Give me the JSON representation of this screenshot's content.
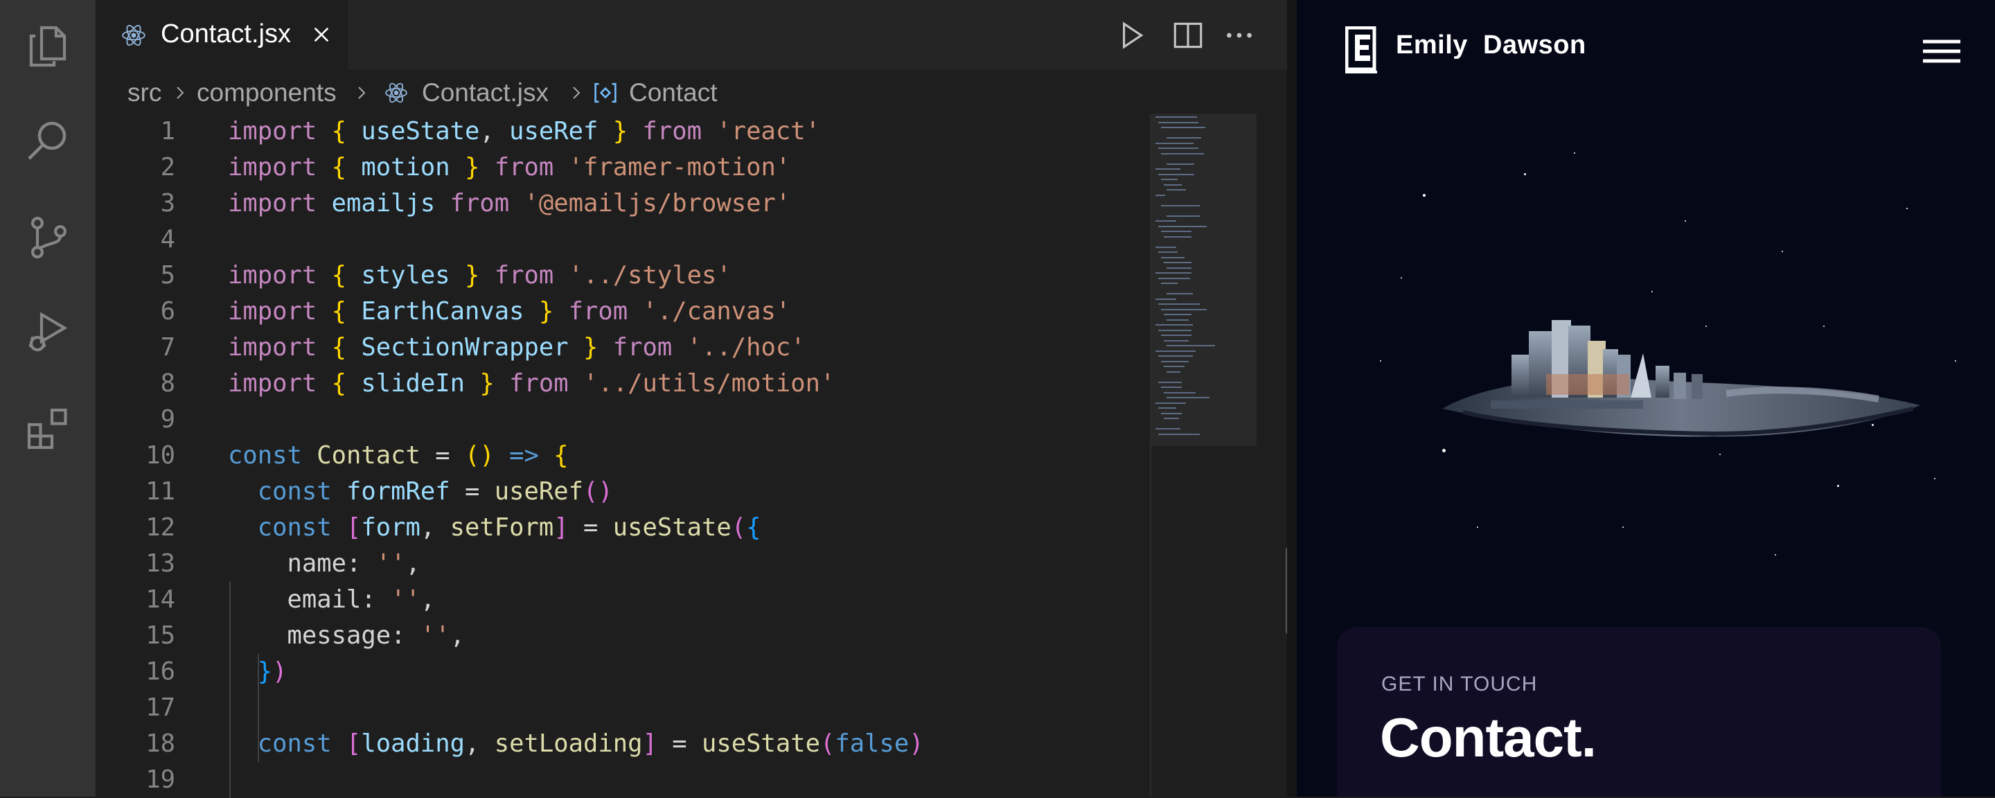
{
  "editor": {
    "tab": {
      "label": "Contact.jsx"
    },
    "breadcrumb": {
      "items": [
        "src",
        "components",
        "Contact.jsx",
        "Contact"
      ]
    },
    "line_numbers": [
      "1",
      "2",
      "3",
      "4",
      "5",
      "6",
      "7",
      "8",
      "9",
      "10",
      "11",
      "12",
      "13",
      "14",
      "15",
      "16",
      "17",
      "18",
      "19"
    ],
    "code_tokens": {
      "import": "import",
      "from": "from",
      "const": "const",
      "false": "false",
      "lb": "{",
      "rb": "}",
      "lp": "(",
      "rp": ")",
      "lbk": "[",
      "rbk": "]",
      "comma": ",",
      "eq": " = ",
      "arrow": " => ",
      "useState": "useState",
      "useRef": "useRef",
      "motion": "motion",
      "emailjs": "emailjs",
      "styles": "styles",
      "EarthCanvas": "EarthCanvas",
      "SectionWrapper": "SectionWrapper",
      "slideIn": "slideIn",
      "Contact": "Contact",
      "formRef": "formRef",
      "form": "form",
      "setForm": "setForm",
      "loading": "loading",
      "setLoading": "setLoading",
      "name_key": "name:",
      "email_key": "email:",
      "message_key": "message:",
      "empty_str": "''",
      "str_react": "'react'",
      "str_framer": "'framer-motion'",
      "str_emailjs": "'@emailjs/browser'",
      "str_styles": "'../styles'",
      "str_canvas": "'./canvas'",
      "str_hoc": "'../hoc'",
      "str_motion": "'../utils/motion'"
    }
  },
  "preview": {
    "site_name": "Emily  Dawson",
    "contact": {
      "eyebrow": "GET IN TOUCH",
      "title": "Contact."
    }
  },
  "icons": {
    "activity_bar": [
      "explorer-icon",
      "search-icon",
      "source-control-icon",
      "run-debug-icon",
      "extensions-icon"
    ],
    "toolbar": [
      "run-icon",
      "split-editor-icon",
      "more-actions-icon"
    ]
  },
  "colors": {
    "keyword": "#c586c0",
    "variable": "#9cdcfe",
    "string": "#ce9178",
    "function": "#dcdcaa",
    "preview_bg": "#050816",
    "card_bg": "#100d25"
  }
}
